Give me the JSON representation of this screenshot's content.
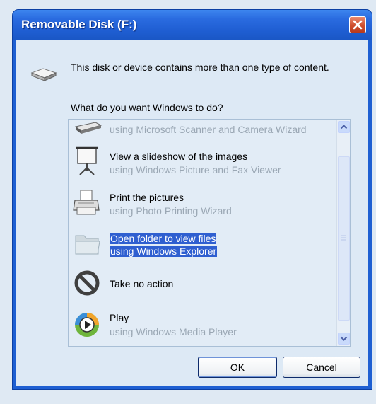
{
  "window": {
    "title": "Removable Disk (F:)"
  },
  "message": "This disk or device contains more than one type of content.",
  "question": "What do you want Windows to do?",
  "actions": [
    {
      "label": "",
      "sublabel": "using Microsoft Scanner and Camera Wizard",
      "icon": "scanner-icon"
    },
    {
      "label": "View a slideshow of the images",
      "sublabel": "using Windows Picture and Fax Viewer",
      "icon": "slideshow-projector-icon"
    },
    {
      "label": "Print the pictures",
      "sublabel": "using Photo Printing Wizard",
      "icon": "printer-icon"
    },
    {
      "label": "Open folder to view files",
      "sublabel": "using Windows Explorer",
      "icon": "folder-icon",
      "selected": true
    },
    {
      "label": "Take no action",
      "sublabel": "",
      "icon": "no-action-icon"
    },
    {
      "label": "Play",
      "sublabel": "using Windows Media Player",
      "icon": "media-player-icon"
    }
  ],
  "buttons": {
    "ok": "OK",
    "cancel": "Cancel"
  },
  "colors": {
    "title_bar": "#1f5ed2",
    "selection": "#2f5fd0",
    "client_background": "#dde9f5"
  }
}
